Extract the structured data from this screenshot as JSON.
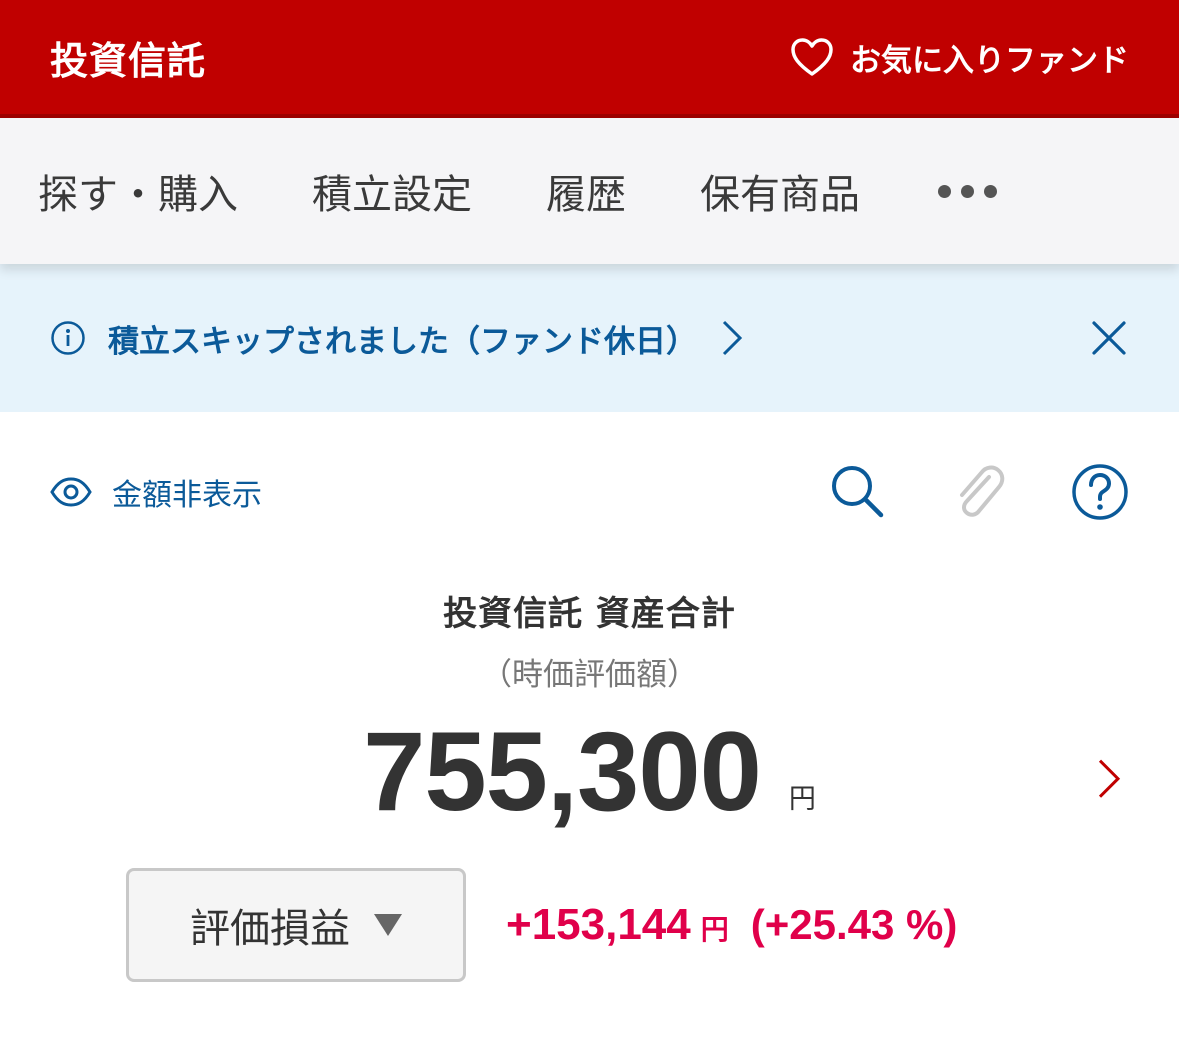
{
  "header": {
    "title": "投資信託",
    "favorite_label": "お気に入りファンド"
  },
  "tabs": [
    {
      "label": "探す・購入"
    },
    {
      "label": "積立設定"
    },
    {
      "label": "履歴"
    },
    {
      "label": "保有商品"
    }
  ],
  "notice": {
    "text": "積立スキップされました（ファンド休日）"
  },
  "tools": {
    "hide_amount_label": "金額非表示"
  },
  "summary": {
    "title": "投資信託 資産合計",
    "subtitle": "（時価評価額）",
    "amount": "755,300",
    "unit": "円"
  },
  "pl": {
    "select_label": "評価損益",
    "value": "+153,144",
    "unit": "円",
    "percent": "(+25.43 %)"
  },
  "colors": {
    "brand_red": "#c00000",
    "link_blue": "#0b5a99",
    "gain_red": "#e0004a",
    "notice_bg": "#e6f3fb"
  },
  "icons": [
    "heart-icon",
    "more-icon",
    "info-icon",
    "chevron-right-icon",
    "close-icon",
    "eye-icon",
    "search-icon",
    "paperclip-icon",
    "help-icon"
  ]
}
